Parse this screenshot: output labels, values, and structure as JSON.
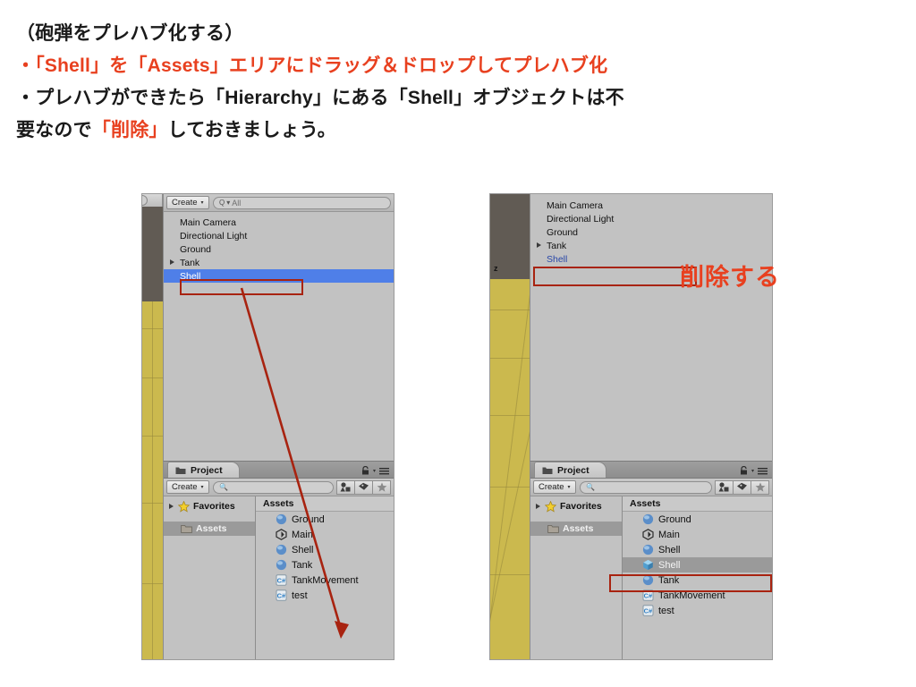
{
  "slide": {
    "heading": "（砲弾をプレハブ化する）",
    "bullet1_prefix": "・",
    "bullet1": "「Shell」を「Assets」エリアにドラッグ＆ドロップしてプレハブ化",
    "bullet2_a": "・プレハブができたら「Hierarchy」にある「Shell」オブジェクトは不",
    "bullet2_b": "要なので",
    "bullet2_red": "「削除」",
    "bullet2_c": "しておきましょう。",
    "colors": {
      "red": "#e8401f",
      "black": "#1a1a1a",
      "annotation_red": "#a82310"
    }
  },
  "left_shot": {
    "scene": {
      "axis_label": ""
    },
    "hierarchy": {
      "toolbar": {
        "create_label": "Create",
        "create_caret": "▾",
        "search_icon": "Q",
        "search_caret": "▾",
        "search_value": "All"
      },
      "items": [
        {
          "label": "Main Camera",
          "expandable": false,
          "selected": false,
          "blue_text": false
        },
        {
          "label": "Directional Light",
          "expandable": false,
          "selected": false,
          "blue_text": false
        },
        {
          "label": "Ground",
          "expandable": false,
          "selected": false,
          "blue_text": false
        },
        {
          "label": "Tank",
          "expandable": true,
          "selected": false,
          "blue_text": false
        },
        {
          "label": "Shell",
          "expandable": false,
          "selected": true,
          "blue_text": false
        }
      ]
    },
    "project": {
      "tab_label": "Project",
      "tab_icon": "folder-icon",
      "lock_icon": "lock-icon",
      "menu_icon": "hamburger-menu-icon",
      "toolbar": {
        "create_label": "Create",
        "create_caret": "▾",
        "search_placeholder": "",
        "icons": [
          "shapes-filter-icon",
          "tag-icon",
          "star-icon"
        ]
      },
      "tree": [
        {
          "label": "Favorites",
          "icon": "star-icon",
          "expandable": true,
          "selected": false,
          "bold": true
        },
        {
          "label": "Assets",
          "icon": "folder-icon",
          "expandable": false,
          "selected": true,
          "bold": true
        }
      ],
      "assets_header": "Assets",
      "assets": [
        {
          "label": "Ground",
          "icon": "material-sphere-icon",
          "selected": false
        },
        {
          "label": "Main",
          "icon": "unity-scene-icon",
          "selected": false
        },
        {
          "label": "Shell",
          "icon": "material-sphere-icon",
          "selected": false
        },
        {
          "label": "Tank",
          "icon": "material-sphere-icon",
          "selected": false
        },
        {
          "label": "TankMovement",
          "icon": "csharp-script-icon",
          "selected": false
        },
        {
          "label": "test",
          "icon": "csharp-script-icon",
          "selected": false
        }
      ]
    },
    "annotations": {
      "highlight_box": "shell-hierarchy-row",
      "arrow": "drag-shell-to-assets-arrow"
    }
  },
  "right_shot": {
    "scene": {
      "axis_label": "z"
    },
    "hierarchy": {
      "items": [
        {
          "label": "Main Camera",
          "expandable": false,
          "selected": false,
          "blue_text": false
        },
        {
          "label": "Directional Light",
          "expandable": false,
          "selected": false,
          "blue_text": false
        },
        {
          "label": "Ground",
          "expandable": false,
          "selected": false,
          "blue_text": false
        },
        {
          "label": "Tank",
          "expandable": true,
          "selected": false,
          "blue_text": false
        },
        {
          "label": "Shell",
          "expandable": false,
          "selected": false,
          "blue_text": true
        }
      ]
    },
    "project": {
      "tab_label": "Project",
      "tab_icon": "folder-icon",
      "lock_icon": "lock-icon",
      "menu_icon": "hamburger-menu-icon",
      "toolbar": {
        "create_label": "Create",
        "create_caret": "▾",
        "search_placeholder": "",
        "icons": [
          "shapes-filter-icon",
          "tag-icon",
          "star-icon"
        ]
      },
      "tree": [
        {
          "label": "Favorites",
          "icon": "star-icon",
          "expandable": true,
          "selected": false,
          "bold": true
        },
        {
          "label": "Assets",
          "icon": "folder-icon",
          "expandable": false,
          "selected": true,
          "bold": true
        }
      ],
      "assets_header": "Assets",
      "assets": [
        {
          "label": "Ground",
          "icon": "material-sphere-icon",
          "selected": false
        },
        {
          "label": "Main",
          "icon": "unity-scene-icon",
          "selected": false
        },
        {
          "label": "Shell",
          "icon": "material-sphere-icon",
          "selected": false
        },
        {
          "label": "Shell",
          "icon": "prefab-cube-icon",
          "selected": true
        },
        {
          "label": "Tank",
          "icon": "material-sphere-icon",
          "selected": false
        },
        {
          "label": "TankMovement",
          "icon": "csharp-script-icon",
          "selected": false
        },
        {
          "label": "test",
          "icon": "csharp-script-icon",
          "selected": false
        }
      ]
    },
    "annotations": {
      "delete_label": "削除する",
      "highlight_box_hierarchy": "shell-hierarchy-row",
      "highlight_box_prefab": "shell-prefab-row"
    }
  }
}
